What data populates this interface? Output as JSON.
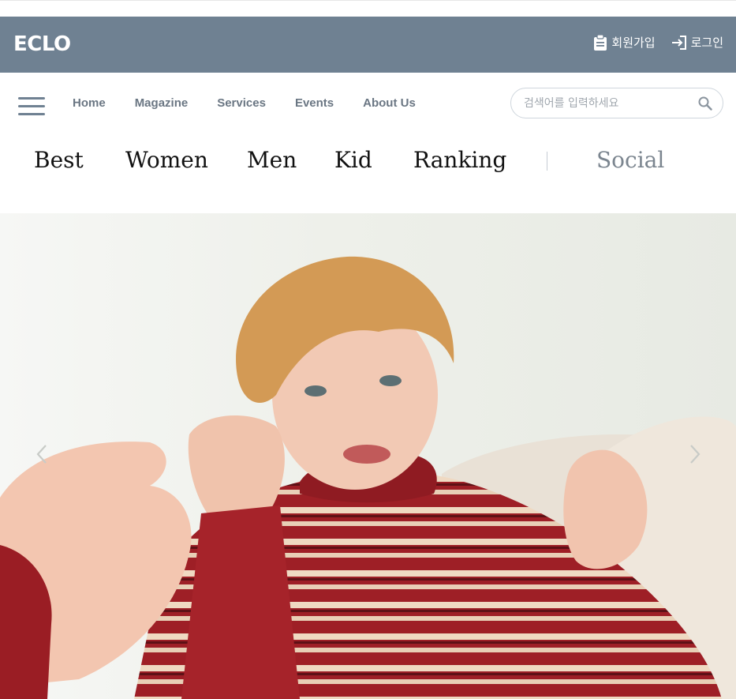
{
  "brand": {
    "logo": "ECLO"
  },
  "auth": {
    "signup_label": "회원가입",
    "login_label": "로그인"
  },
  "nav": {
    "links": [
      "Home",
      "Magazine",
      "Services",
      "Events",
      "About Us"
    ]
  },
  "search": {
    "placeholder": "검색어를 입력하세요",
    "value": ""
  },
  "categories": [
    "Best",
    "Women",
    "Men",
    "Kid",
    "Ranking",
    "Social"
  ],
  "hero": {
    "image": "child-in-striped-sweater-photo"
  },
  "colors": {
    "header_bg": "#6f8192",
    "nav_text": "#6a7683",
    "category_text": "#111111",
    "social_text": "#7b858f"
  },
  "icons": {
    "signup": "clipboard-icon",
    "login": "login-icon",
    "search": "search-icon",
    "menu": "hamburger-icon",
    "prev": "chevron-left-icon",
    "next": "chevron-right-icon"
  }
}
